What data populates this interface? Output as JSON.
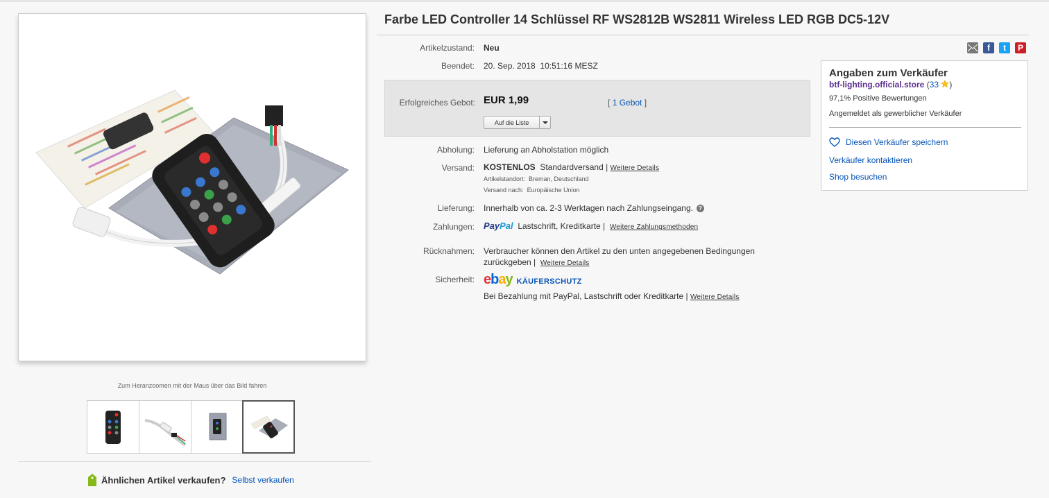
{
  "gallery": {
    "zoom_hint": "Zum Heranzoomen mit der Maus über das Bild fahren",
    "sell_question": "Ähnlichen Artikel verkaufen?",
    "sell_link": "Selbst verkaufen"
  },
  "item": {
    "title": "Farbe LED Controller 14 Schlüssel RF WS2812B WS2811 Wireless LED RGB DC5-12V"
  },
  "details": {
    "condition_label": "Artikelzustand:",
    "condition_value": "Neu",
    "ended_label": "Beendet:",
    "ended_value": "20. Sep. 2018  10:51:16 MESZ",
    "bid_label": "Erfolgreiches Gebot:",
    "price": "EUR 1,99",
    "bids_open": "[",
    "bids_link": "1 Gebot",
    "bids_close": "]",
    "watch_button": "Auf die Liste",
    "pickup_label": "Abholung:",
    "pickup_value": "Lieferung an Abholstation möglich",
    "shipping_label": "Versand:",
    "shipping_free": "KOSTENLOS",
    "shipping_method": "Standardversand |",
    "shipping_more": "Weitere Details",
    "location_label": "Artikelstandort:",
    "location_value": "Breman, Deutschland",
    "ships_to_label": "Versand nach:",
    "ships_to_value": "Europäische Union",
    "delivery_label": "Lieferung:",
    "delivery_value": "Innerhalb von ca. 2-3 Werktagen nach Zahlungseingang.",
    "payments_label": "Zahlungen:",
    "paypal_1": "Pay",
    "paypal_2": "Pal",
    "payments_methods": "Lastschrift,  Kreditkarte  |",
    "payments_more": "Weitere Zahlungsmethoden",
    "returns_label": "Rücknahmen:",
    "returns_line1": "Verbraucher können den Artikel zu den unten angegebenen Bedingungen",
    "returns_line2": "zurückgeben |",
    "returns_more": "Weitere Details",
    "security_label": "Sicherheit:",
    "buyer_protection": "KÄUFERSCHUTZ",
    "security_text": "Bei Bezahlung mit PayPal, Lastschrift oder Kreditkarte |",
    "security_more": "Weitere Details"
  },
  "ebay_logo": {
    "e": "e",
    "b": "b",
    "a": "a",
    "y": "y"
  },
  "seller": {
    "heading": "Angaben zum Verkäufer",
    "store_name": "btf-lighting.official.store",
    "feedback_open": "(",
    "feedback_count": "33",
    "feedback_close": ")",
    "positive": "97,1% Positive Bewertungen",
    "registered": "Angemeldet als gewerblicher Verkäufer",
    "save_seller": "Diesen Verkäufer speichern",
    "contact_seller": "Verkäufer kontaktieren",
    "visit_shop": "Shop besuchen"
  },
  "share": {
    "facebook": "f",
    "twitter": "t",
    "pinterest": "P"
  },
  "colors": {
    "link": "#0654ba",
    "store": "#5d2f91",
    "bid_box": "#e5e5e5"
  }
}
